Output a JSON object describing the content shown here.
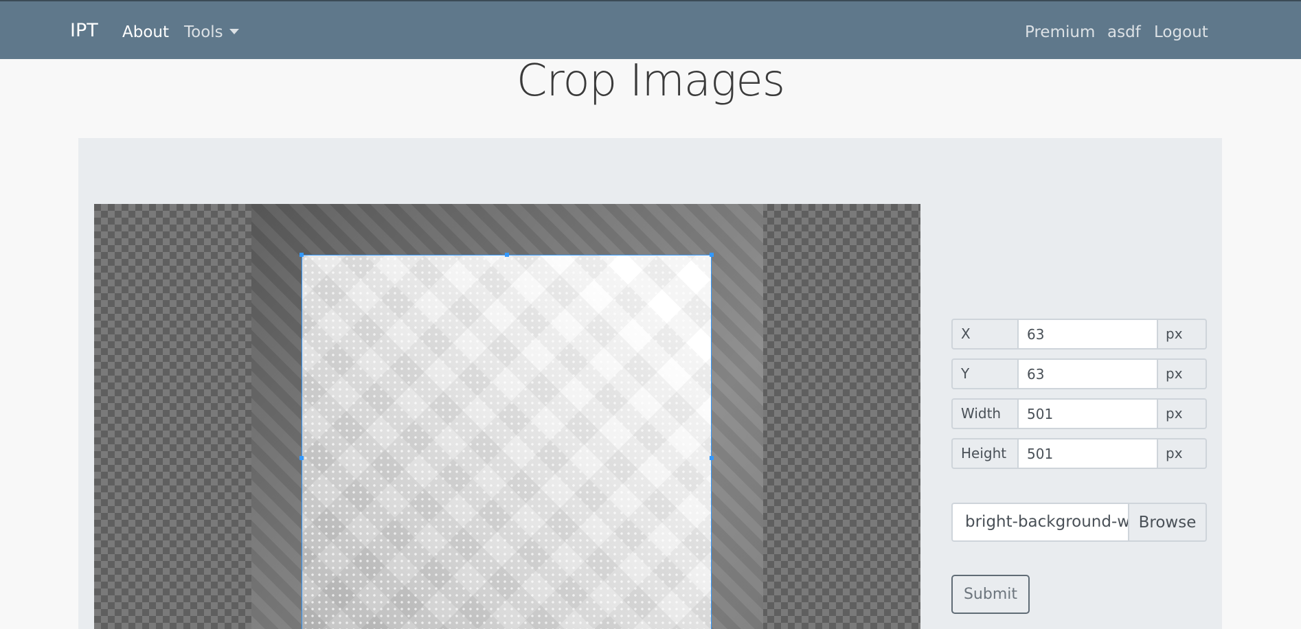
{
  "navbar": {
    "brand": "IPT",
    "about": "About",
    "tools": "Tools",
    "premium": "Premium",
    "user": "asdf",
    "logout": "Logout"
  },
  "page": {
    "title": "Crop Images"
  },
  "crop_form": {
    "x": {
      "label": "X",
      "value": "63",
      "unit": "px"
    },
    "y": {
      "label": "Y",
      "value": "63",
      "unit": "px"
    },
    "width": {
      "label": "Width",
      "value": "501",
      "unit": "px"
    },
    "height": {
      "label": "Height",
      "value": "501",
      "unit": "px"
    }
  },
  "file": {
    "name": "bright-background-with-dots.jpg",
    "browse_label": "Browse"
  },
  "submit_label": "Submit",
  "colors": {
    "navbar": "#5f788b",
    "crop_border": "#3399ff",
    "card_bg": "#e9ecef"
  }
}
